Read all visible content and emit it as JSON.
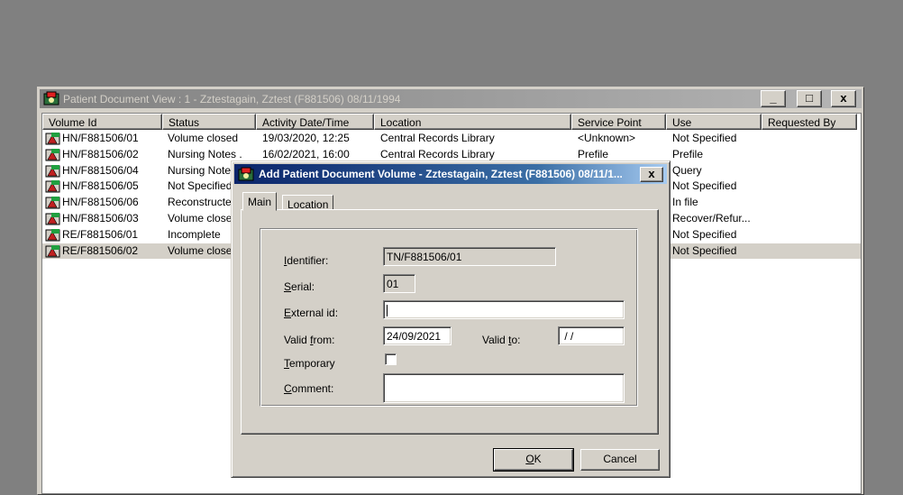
{
  "main_window": {
    "title": "Patient Document View : 1 - Zztestagain, Zztest (F881506) 08/11/1994",
    "minimize_label": "_",
    "maximize_label": "□",
    "close_label": "x"
  },
  "columns": [
    "Volume Id",
    "Status",
    "Activity Date/Time",
    "Location",
    "Service Point",
    "Use",
    "Requested By"
  ],
  "rows": [
    {
      "volume_id": "HN/F881506/01",
      "status": "Volume closed",
      "activity": "19/03/2020, 12:25",
      "location": "Central Records Library",
      "service_point": "<Unknown>",
      "use": "Not Specified",
      "requested_by": ""
    },
    {
      "volume_id": "HN/F881506/02",
      "status": "Nursing Notes .",
      "activity": "16/02/2021, 16:00",
      "location": "Central Records Library",
      "service_point": "Prefile",
      "use": "Prefile",
      "requested_by": ""
    },
    {
      "volume_id": "HN/F881506/04",
      "status": "Nursing Note:",
      "activity": "",
      "location": "",
      "service_point": "",
      "use": "Query",
      "requested_by": ""
    },
    {
      "volume_id": "HN/F881506/05",
      "status": "Not Specified",
      "activity": "",
      "location": "",
      "service_point": "",
      "use": "Not Specified",
      "requested_by": ""
    },
    {
      "volume_id": "HN/F881506/06",
      "status": "Reconstructe",
      "activity": "",
      "location": "",
      "service_point": "",
      "use": "In file",
      "requested_by": ""
    },
    {
      "volume_id": "HN/F881506/03",
      "status": "Volume close",
      "activity": "",
      "location": "",
      "service_point": "",
      "use": "Recover/Refur...",
      "requested_by": ""
    },
    {
      "volume_id": "RE/F881506/01",
      "status": "Incomplete",
      "activity": "",
      "location": "",
      "service_point": "",
      "use": "Not Specified",
      "requested_by": ""
    },
    {
      "volume_id": "RE/F881506/02",
      "status": "Volume close",
      "activity": "",
      "location": "",
      "service_point": "",
      "use": "Not Specified",
      "requested_by": ""
    }
  ],
  "dialog": {
    "title": "Add Patient Document Volume - Zztestagain, Zztest (F881506) 08/11/1...",
    "close_label": "x",
    "tabs": [
      "Main",
      "Location"
    ],
    "identifier_label_u": "I",
    "identifier_label_rest": "dentifier:",
    "identifier_value": "TN/F881506/01",
    "serial_label_u": "S",
    "serial_label_rest": "erial:",
    "serial_value": "01",
    "external_label_u": "E",
    "external_label_rest": "xternal id:",
    "external_value": "",
    "valid_from_label_pre": "Valid ",
    "valid_from_label_u": "f",
    "valid_from_label_rest": "rom:",
    "valid_from_value": "24/09/2021",
    "valid_to_label_pre": "Valid ",
    "valid_to_label_u": "t",
    "valid_to_label_rest": "o:",
    "valid_to_value": " / /",
    "temporary_label_u": "T",
    "temporary_label_rest": "emporary",
    "comment_label_u": "C",
    "comment_label_rest": "omment:",
    "comment_value": "",
    "ok_label_u": "O",
    "ok_label_rest": "K",
    "cancel_label": "Cancel"
  }
}
